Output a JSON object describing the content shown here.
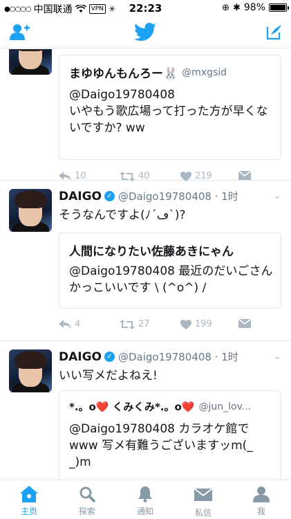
{
  "status_bar": {
    "signal": "●○○○○",
    "carrier": "中国联通",
    "vpn": "VPN",
    "time": "22:23",
    "battery": "98%",
    "battery_level": 0.98
  },
  "nav": {
    "add_user_icon": "add-user-icon",
    "logo_icon": "twitter-bird-icon",
    "compose_icon": "compose-icon"
  },
  "tweets": [
    {
      "quote": {
        "name": "まゆゆんもんろー🐰",
        "handle": "@mxgsid",
        "text": "@Daigo19780408\nいやもう歌広場って打った方が早くないですか? ww"
      },
      "actions": {
        "reply": "10",
        "retweet": "40",
        "like": "219"
      }
    },
    {
      "author": "DAIGO",
      "handle": "@Daigo19780408 · 1时",
      "text": "そうなんですよ(ﾉ´ڡ`)?",
      "quote": {
        "name": "人間になりたい佐藤あきにゃん",
        "handle": "",
        "text": "@Daigo19780408 最近のだいごさんかっこいいです \\ (^o^) /"
      },
      "actions": {
        "reply": "4",
        "retweet": "27",
        "like": "199"
      }
    },
    {
      "author": "DAIGO",
      "handle": "@Daigo19780408 · 1时",
      "text": "いい写メだよねえ!",
      "quote": {
        "name": "*.。o❤️ くみくみ*.。o❤️",
        "handle": "@jun_lov...",
        "text": "@Daigo19780408 カラオケ館でwww 写メ有難うございますッm(_ _)m"
      }
    }
  ],
  "tabs": [
    {
      "label": "主页",
      "icon": "home-icon",
      "active": true
    },
    {
      "label": "探索",
      "icon": "search-icon",
      "active": false
    },
    {
      "label": "通知",
      "icon": "bell-icon",
      "active": false
    },
    {
      "label": "私信",
      "icon": "mail-icon",
      "active": false
    },
    {
      "label": "我",
      "icon": "profile-icon",
      "active": false
    }
  ],
  "colors": {
    "accent": "#1da1f2",
    "muted": "#aab8c2",
    "border": "#e1e8ed"
  }
}
